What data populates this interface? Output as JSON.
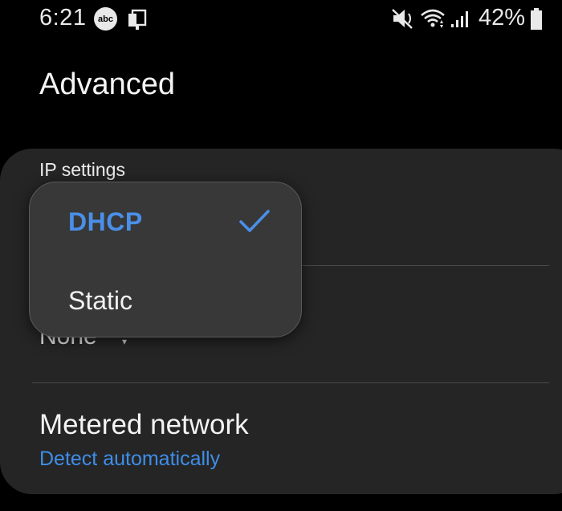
{
  "status_bar": {
    "time": "6:21",
    "abc_badge": "abc",
    "battery_percent": "42%",
    "icons": [
      "abc-icon",
      "cast-icon",
      "mute-icon",
      "wifi-icon",
      "signal-icon",
      "battery-icon"
    ]
  },
  "page": {
    "title": "Advanced"
  },
  "ip_settings": {
    "label": "IP settings",
    "options": [
      {
        "label": "DHCP",
        "selected": true
      },
      {
        "label": "Static",
        "selected": false
      }
    ]
  },
  "proxy": {
    "value": "None"
  },
  "metered_network": {
    "title": "Metered network",
    "value": "Detect automatically"
  },
  "colors": {
    "accent": "#3e8ee9",
    "background": "#000000",
    "card": "#252525",
    "popup": "#383838"
  }
}
